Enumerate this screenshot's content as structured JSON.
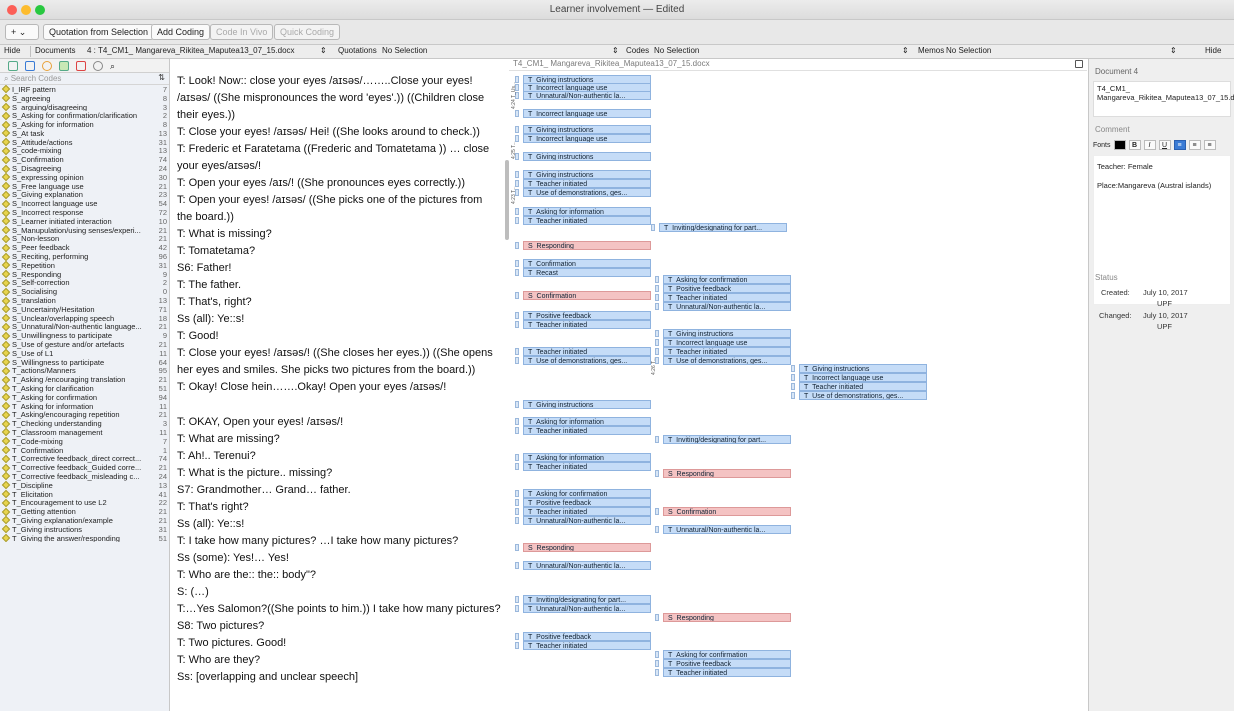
{
  "window": {
    "title": "Learner involvement — Edited"
  },
  "toolbar": {
    "add": "+ ⌄",
    "quotation_from_selection": "Quotation from Selection",
    "add_coding": "Add Coding",
    "code_in_vivo": "Code In Vivo",
    "quick_coding": "Quick Coding"
  },
  "navbar": {
    "hide_left": "Hide",
    "documents": "Documents",
    "document_sel": "4 : T4_CM1_ Mangareva_Rikitea_Maputea13_07_15.docx",
    "quotations": "Quotations",
    "quotations_sel": "No Selection",
    "codes": "Codes",
    "codes_sel": "No Selection",
    "memos": "Memos",
    "memos_sel": "No Selection",
    "hide_right": "Hide"
  },
  "search": {
    "placeholder": "Search Codes"
  },
  "codes": [
    {
      "name": "I_IRF pattern",
      "count": "7"
    },
    {
      "name": "S_agreeing",
      "count": "8"
    },
    {
      "name": "S_arguing/disagreeing",
      "count": "3"
    },
    {
      "name": "S_Asking for confirmation/clarification",
      "count": "2"
    },
    {
      "name": "S_Asking for information",
      "count": "8"
    },
    {
      "name": "S_At task",
      "count": "13"
    },
    {
      "name": "S_Attitude/actions",
      "count": "31"
    },
    {
      "name": "S_code-mixing",
      "count": "13"
    },
    {
      "name": "S_Confirmation",
      "count": "74"
    },
    {
      "name": "S_Disagreeing",
      "count": "24"
    },
    {
      "name": "S_expressing opinion",
      "count": "30"
    },
    {
      "name": "S_Free language use",
      "count": "21"
    },
    {
      "name": "S_Giving explanation",
      "count": "23"
    },
    {
      "name": "S_Incorrect language use",
      "count": "54"
    },
    {
      "name": "S_Incorrect response",
      "count": "72"
    },
    {
      "name": "S_Learner initiated interaction",
      "count": "10"
    },
    {
      "name": "S_Manupulation/using senses/experi...",
      "count": "21"
    },
    {
      "name": "S_Non-lesson",
      "count": "21"
    },
    {
      "name": "S_Peer feedback",
      "count": "42"
    },
    {
      "name": "S_Reciting, performing",
      "count": "96"
    },
    {
      "name": "S_Repetition",
      "count": "31"
    },
    {
      "name": "S_Responding",
      "count": "9"
    },
    {
      "name": "S_Self-correction",
      "count": "2"
    },
    {
      "name": "S_Socialising",
      "count": "0"
    },
    {
      "name": "S_translation",
      "count": "13"
    },
    {
      "name": "S_Uncertainty/Hesitation",
      "count": "71"
    },
    {
      "name": "S_Unclear/overlapping speech",
      "count": "18"
    },
    {
      "name": "S_Unnatural/Non-authentic language...",
      "count": "21"
    },
    {
      "name": "S_Unwillingness to participate",
      "count": "9"
    },
    {
      "name": "S_Use of gesture and/or artefacts",
      "count": "21"
    },
    {
      "name": "S_Use of L1",
      "count": "11"
    },
    {
      "name": "S_Willingness to participate",
      "count": "64"
    },
    {
      "name": "T_actions/Manners",
      "count": "95"
    },
    {
      "name": "T_Asking /encouraging translation",
      "count": "21"
    },
    {
      "name": "T_Asking for clarification",
      "count": "51"
    },
    {
      "name": "T_Asking for confirmation",
      "count": "94"
    },
    {
      "name": "T_Asking for information",
      "count": "11"
    },
    {
      "name": "T_Asking/encouraging repetition",
      "count": "21"
    },
    {
      "name": "T_Checking understanding",
      "count": "3"
    },
    {
      "name": "T_Classroom management",
      "count": "11"
    },
    {
      "name": "T_Code-mixing",
      "count": "7"
    },
    {
      "name": "T_Confirmation",
      "count": "1"
    },
    {
      "name": "T_Corrective feedback_direct correct...",
      "count": "74"
    },
    {
      "name": "T_Corrective feedback_Guided corre...",
      "count": "21"
    },
    {
      "name": "T_Corrective feedback_misleading c...",
      "count": "24"
    },
    {
      "name": "T_Discipline",
      "count": "13"
    },
    {
      "name": "T_Elicitation",
      "count": "41"
    },
    {
      "name": "T_Encouragement to use L2",
      "count": "22"
    },
    {
      "name": "T_Getting attention",
      "count": "21"
    },
    {
      "name": "T_Giving explanation/example",
      "count": "21"
    },
    {
      "name": "T_Giving instructions",
      "count": "31"
    },
    {
      "name": "T_Giving the answer/responding",
      "count": "51"
    }
  ],
  "transcript": {
    "header": "T4_CM1_ Mangareva_Rikitea_Maputea13_07_15.docx",
    "lines": [
      "T: Look! Now:: close your eyes /aɪsəs/……..Close your eyes!",
      "/aɪsəs/ ((She mispronounces the word 'eyes'.)) ((Children close",
      "their eyes.))",
      "T: Close your eyes! /aɪsəs/ Hei! ((She looks around to check.))",
      "T: Frederic et Faratetama ((Frederic and Tomatetama )) … close",
      "your eyes/aɪsəs/!",
      "T: Open your eyes /aɪs/!  ((She pronounces eyes correctly.))",
      "T: Open your eyes! /aɪsəs/ ((She picks one of the pictures from",
      "the board.))",
      "T: What is missing?",
      "T: Tomatetama?",
      "S6: Father!",
      "T: The father.",
      "T: That's, right?",
      "Ss (all): Ye::s!",
      "T: Good!",
      "T: Close your eyes! /aɪsəs/! ((She closes her eyes.)) ((She opens",
      "her eyes and smiles. She picks two pictures from the board.))",
      "T: Okay! Close hein…….Okay! Open your eyes /aɪsəs/!",
      "T: OKAY, Open your eyes! /aɪsəs/!",
      "T: What are missing?",
      "T: Ah!.. Terenui?",
      "T: What is the picture.. missing?",
      "S7: Grandmother… Grand… father.",
      "T: That's right?",
      "Ss (all): Ye::s!",
      "T: I take how many pictures? …I take how many pictures?",
      "Ss (some): Yes!… Yes!",
      "T: Who are the:: the:: body\"?",
      "S: (…)",
      "T:…Yes Salomon?((She points to him.))  I take how many pictures?",
      "S8: Two pictures?",
      "T: Two pictures. Good!",
      "T: Who are they?",
      "Ss: [overlapping and unclear speech]"
    ]
  },
  "tags": [
    "T_Giving instructions",
    "T_Incorrect language use",
    "T_Unnatural/Non-authentic la...",
    "T_Incorrect language use",
    "T_Giving instructions",
    "T_Incorrect language use",
    "T_Giving instructions",
    "T_Giving instructions",
    "T_Teacher initiated",
    "T_Use of demonstrations, ges...",
    "T_Asking for information",
    "T_Teacher initiated",
    "T_Inviting/designating for part...",
    "S_Responding",
    "T_Confirmation",
    "T_Recast",
    "T_Asking for confirmation",
    "T_Positive feedback",
    "T_Teacher initiated",
    "S_Confirmation",
    "T_Unnatural/Non-authentic la...",
    "T_Positive feedback",
    "T_Teacher initiated",
    "T_Giving instructions",
    "T_Incorrect language use",
    "T_Teacher initiated",
    "T_Teacher initiated",
    "T_Use of demonstrations, ges...",
    "T_Use of demonstrations, ges...",
    "T_Giving instructions",
    "T_Incorrect language use",
    "T_Teacher initiated",
    "T_Use of demonstrations, ges...",
    "T_Giving instructions",
    "T_Asking for information",
    "T_Teacher initiated",
    "T_Inviting/designating for part...",
    "T_Asking for information",
    "T_Teacher initiated",
    "S_Responding",
    "T_Asking for confirmation",
    "T_Positive feedback",
    "T_Teacher initiated",
    "S_Confirmation",
    "T_Unnatural/Non-authentic la...",
    "T_Unnatural/Non-authentic la...",
    "S_Responding",
    "T_Unnatural/Non-authentic la...",
    "T_Inviting/designating for part...",
    "T_Unnatural/Non-authentic la...",
    "S_Responding",
    "T_Positive feedback",
    "T_Teacher initiated",
    "T_Asking for confirmation",
    "T_Positive feedback",
    "T_Teacher initiated"
  ],
  "brackets": [
    "4:24 T_Us...",
    "4:25 T...",
    "4:23 T...",
    "4:26 T..."
  ],
  "right": {
    "doc_label": "Document 4",
    "doc_name": "T4_CM1_ Mangareva_Rikitea_Maputea13_07_15.docx",
    "comment_label": "Comment",
    "fonts": "Fonts",
    "comment_line1": "Teacher: Female",
    "comment_line2": "Place:Mangareva (Austral islands)",
    "status_label": "Status",
    "created_label": "Created:",
    "created_date": "July 10, 2017",
    "created_by": "UPF",
    "changed_label": "Changed:",
    "changed_date": "July 10, 2017",
    "changed_by": "UPF"
  },
  "colors": {
    "tag_blue": "#c5dcf7",
    "tag_pink": "#f4c3c3",
    "code_icon": "#e8d44d"
  }
}
